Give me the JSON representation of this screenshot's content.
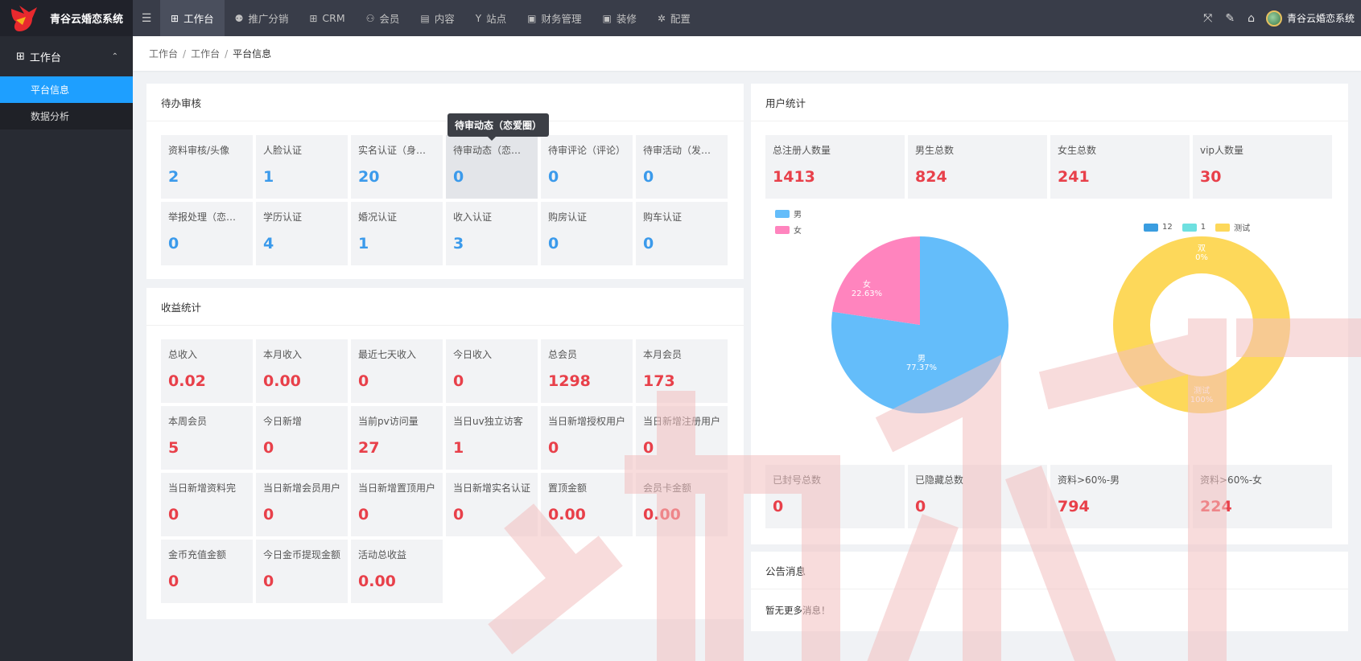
{
  "app": {
    "name": "青谷云婚恋系统"
  },
  "nav": {
    "items": [
      {
        "icon": "grid-icon",
        "glyph": "⊞",
        "label": "工作台",
        "active": true
      },
      {
        "icon": "user-share-icon",
        "glyph": "⚉",
        "label": "推广分销",
        "active": false
      },
      {
        "icon": "grid-icon",
        "glyph": "⊞",
        "label": "CRM",
        "active": false
      },
      {
        "icon": "users-icon",
        "glyph": "⚇",
        "label": "会员",
        "active": false
      },
      {
        "icon": "document-icon",
        "glyph": "▤",
        "label": "内容",
        "active": false
      },
      {
        "icon": "fork-icon",
        "glyph": "Y",
        "label": "站点",
        "active": false
      },
      {
        "icon": "finance-icon",
        "glyph": "▣",
        "label": "财务管理",
        "active": false
      },
      {
        "icon": "decor-icon",
        "glyph": "▣",
        "label": "装修",
        "active": false
      },
      {
        "icon": "gear-icon",
        "glyph": "✲",
        "label": "配置",
        "active": false
      }
    ],
    "user_name": "青谷云婚恋系统"
  },
  "sidebar": {
    "group_label": "工作台",
    "items": [
      {
        "label": "平台信息",
        "active": true
      },
      {
        "label": "数据分析",
        "active": false
      }
    ]
  },
  "breadcrumb": [
    "工作台",
    "工作台",
    "平台信息"
  ],
  "pending": {
    "title": "待办审核",
    "tooltip": "待审动态（恋爱圈）",
    "cells": [
      {
        "label": "资料审核/头像",
        "value": "2"
      },
      {
        "label": "人脸认证",
        "value": "1"
      },
      {
        "label": "实名认证（身份证...",
        "value": "20"
      },
      {
        "label": "待审动态（恋爱圈...",
        "value": "0"
      },
      {
        "label": "待审评论（评论）",
        "value": "0"
      },
      {
        "label": "待审活动（发布的...",
        "value": "0"
      },
      {
        "label": "举报处理（恋爱圈...",
        "value": "0"
      },
      {
        "label": "学历认证",
        "value": "4"
      },
      {
        "label": "婚况认证",
        "value": "1"
      },
      {
        "label": "收入认证",
        "value": "3"
      },
      {
        "label": "购房认证",
        "value": "0"
      },
      {
        "label": "购车认证",
        "value": "0"
      }
    ]
  },
  "income": {
    "title": "收益统计",
    "cells": [
      {
        "label": "总收入",
        "value": "0.02"
      },
      {
        "label": "本月收入",
        "value": "0.00"
      },
      {
        "label": "最近七天收入",
        "value": "0"
      },
      {
        "label": "今日收入",
        "value": "0"
      },
      {
        "label": "总会员",
        "value": "1298"
      },
      {
        "label": "本月会员",
        "value": "173"
      },
      {
        "label": "本周会员",
        "value": "5"
      },
      {
        "label": "今日新增",
        "value": "0"
      },
      {
        "label": "当前pv访问量",
        "value": "27"
      },
      {
        "label": "当日uv独立访客",
        "value": "1"
      },
      {
        "label": "当日新增授权用户",
        "value": "0"
      },
      {
        "label": "当日新增注册用户",
        "value": "0"
      },
      {
        "label": "当日新增资料完",
        "value": "0"
      },
      {
        "label": "当日新增会员用户",
        "value": "0"
      },
      {
        "label": "当日新增置顶用户",
        "value": "0"
      },
      {
        "label": "当日新增实名认证",
        "value": "0"
      },
      {
        "label": "置顶金额",
        "value": "0.00"
      },
      {
        "label": "会员卡金额",
        "value": "0.00"
      },
      {
        "label": "金币充值金额",
        "value": "0"
      },
      {
        "label": "今日金币提现金额",
        "value": "0"
      },
      {
        "label": "活动总收益",
        "value": "0.00"
      }
    ]
  },
  "user_stats": {
    "title": "用户统计",
    "top": [
      {
        "label": "总注册人数量",
        "value": "1413"
      },
      {
        "label": "男生总数",
        "value": "824"
      },
      {
        "label": "女生总数",
        "value": "241"
      },
      {
        "label": "vip人数量",
        "value": "30"
      }
    ],
    "bottom": [
      {
        "label": "已封号总数",
        "value": "0"
      },
      {
        "label": "已隐藏总数",
        "value": "0"
      },
      {
        "label": "资料>60%-男",
        "value": "794"
      },
      {
        "label": "资料>60%-女",
        "value": "224"
      }
    ]
  },
  "notice": {
    "title": "公告消息",
    "text": "暂无更多消息！"
  },
  "chart_data": [
    {
      "type": "pie",
      "legend_position": "top-left",
      "slices": [
        {
          "name": "男",
          "percent": 77.37,
          "color": "#64bdfa"
        },
        {
          "name": "女",
          "percent": 22.63,
          "color": "#ff84be"
        }
      ],
      "labels": [
        {
          "name": "男",
          "text": "77.37%"
        },
        {
          "name": "女",
          "text": "22.63%"
        }
      ]
    },
    {
      "type": "pie",
      "variant": "donut",
      "legend_position": "top-center",
      "legend": [
        {
          "name": "12",
          "color": "#3a9de0"
        },
        {
          "name": "1",
          "color": "#6ee0e0"
        },
        {
          "name": "测试",
          "color": "#fdd85a"
        }
      ],
      "slices": [
        {
          "name": "测试",
          "percent": 100,
          "color": "#fdd85a"
        }
      ],
      "labels": [
        {
          "name": "双",
          "text": "0%"
        },
        {
          "name": "测试",
          "text": "100%"
        }
      ]
    }
  ],
  "colors": {
    "header_bg": "#393d49",
    "sidebar_bg": "#282b33",
    "accent": "#1e9fff",
    "value_blue": "#3b9aeb",
    "value_red": "#e8404a"
  }
}
